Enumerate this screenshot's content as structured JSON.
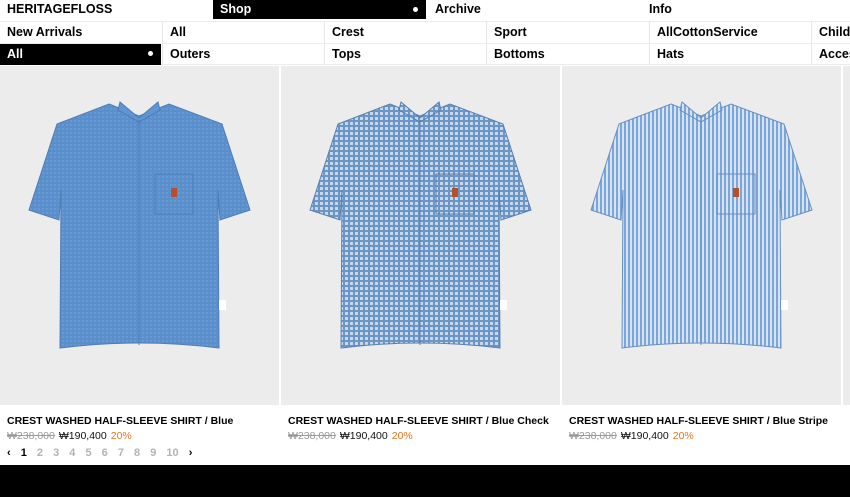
{
  "nav": {
    "brand": "HERITAGEFLOSS",
    "top": [
      "Shop",
      "Archive",
      "Info"
    ],
    "categories": [
      "New Arrivals",
      "All",
      "Crest",
      "Sport",
      "AllCottonService",
      "Childr"
    ],
    "subcategories": [
      "All",
      "Outers",
      "Tops",
      "Bottoms",
      "Hats",
      "Access"
    ]
  },
  "products": [
    {
      "title": "CREST WASHED HALF-SLEEVE SHIRT / Blue",
      "old_price": "₩238,000",
      "price": "₩190,400",
      "discount": "20%",
      "color": "#5b8fcb"
    },
    {
      "title": "CREST WASHED HALF-SLEEVE SHIRT / Blue Check",
      "old_price": "₩238,000",
      "price": "₩190,400",
      "discount": "20%",
      "color": "#7ea3c9"
    },
    {
      "title": "CREST WASHED HALF-SLEEVE SHIRT / Blue Stripe",
      "old_price": "₩238,000",
      "price": "₩190,400",
      "discount": "20%",
      "color": "#8fb2dc"
    }
  ],
  "pagination": {
    "prev": "‹",
    "pages": [
      "1",
      "2",
      "3",
      "4",
      "5",
      "6",
      "7",
      "8",
      "9",
      "10"
    ],
    "next": "›"
  }
}
